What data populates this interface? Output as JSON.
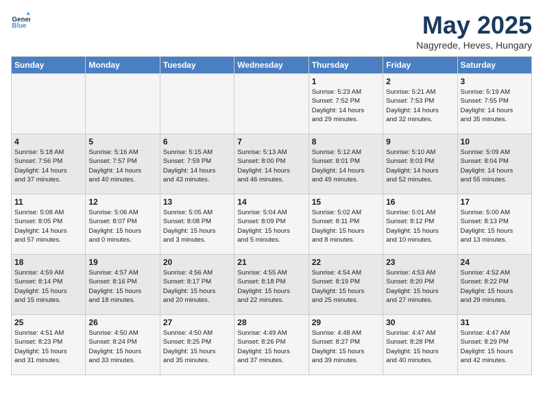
{
  "header": {
    "logo_general": "General",
    "logo_blue": "Blue",
    "title": "May 2025",
    "subtitle": "Nagyrede, Heves, Hungary"
  },
  "calendar": {
    "days_of_week": [
      "Sunday",
      "Monday",
      "Tuesday",
      "Wednesday",
      "Thursday",
      "Friday",
      "Saturday"
    ],
    "weeks": [
      [
        {
          "day": "",
          "info": ""
        },
        {
          "day": "",
          "info": ""
        },
        {
          "day": "",
          "info": ""
        },
        {
          "day": "",
          "info": ""
        },
        {
          "day": "1",
          "info": "Sunrise: 5:23 AM\nSunset: 7:52 PM\nDaylight: 14 hours\nand 29 minutes."
        },
        {
          "day": "2",
          "info": "Sunrise: 5:21 AM\nSunset: 7:53 PM\nDaylight: 14 hours\nand 32 minutes."
        },
        {
          "day": "3",
          "info": "Sunrise: 5:19 AM\nSunset: 7:55 PM\nDaylight: 14 hours\nand 35 minutes."
        }
      ],
      [
        {
          "day": "4",
          "info": "Sunrise: 5:18 AM\nSunset: 7:56 PM\nDaylight: 14 hours\nand 37 minutes."
        },
        {
          "day": "5",
          "info": "Sunrise: 5:16 AM\nSunset: 7:57 PM\nDaylight: 14 hours\nand 40 minutes."
        },
        {
          "day": "6",
          "info": "Sunrise: 5:15 AM\nSunset: 7:59 PM\nDaylight: 14 hours\nand 43 minutes."
        },
        {
          "day": "7",
          "info": "Sunrise: 5:13 AM\nSunset: 8:00 PM\nDaylight: 14 hours\nand 46 minutes."
        },
        {
          "day": "8",
          "info": "Sunrise: 5:12 AM\nSunset: 8:01 PM\nDaylight: 14 hours\nand 49 minutes."
        },
        {
          "day": "9",
          "info": "Sunrise: 5:10 AM\nSunset: 8:03 PM\nDaylight: 14 hours\nand 52 minutes."
        },
        {
          "day": "10",
          "info": "Sunrise: 5:09 AM\nSunset: 8:04 PM\nDaylight: 14 hours\nand 55 minutes."
        }
      ],
      [
        {
          "day": "11",
          "info": "Sunrise: 5:08 AM\nSunset: 8:05 PM\nDaylight: 14 hours\nand 57 minutes."
        },
        {
          "day": "12",
          "info": "Sunrise: 5:06 AM\nSunset: 8:07 PM\nDaylight: 15 hours\nand 0 minutes."
        },
        {
          "day": "13",
          "info": "Sunrise: 5:05 AM\nSunset: 8:08 PM\nDaylight: 15 hours\nand 3 minutes."
        },
        {
          "day": "14",
          "info": "Sunrise: 5:04 AM\nSunset: 8:09 PM\nDaylight: 15 hours\nand 5 minutes."
        },
        {
          "day": "15",
          "info": "Sunrise: 5:02 AM\nSunset: 8:11 PM\nDaylight: 15 hours\nand 8 minutes."
        },
        {
          "day": "16",
          "info": "Sunrise: 5:01 AM\nSunset: 8:12 PM\nDaylight: 15 hours\nand 10 minutes."
        },
        {
          "day": "17",
          "info": "Sunrise: 5:00 AM\nSunset: 8:13 PM\nDaylight: 15 hours\nand 13 minutes."
        }
      ],
      [
        {
          "day": "18",
          "info": "Sunrise: 4:59 AM\nSunset: 8:14 PM\nDaylight: 15 hours\nand 15 minutes."
        },
        {
          "day": "19",
          "info": "Sunrise: 4:57 AM\nSunset: 8:16 PM\nDaylight: 15 hours\nand 18 minutes."
        },
        {
          "day": "20",
          "info": "Sunrise: 4:56 AM\nSunset: 8:17 PM\nDaylight: 15 hours\nand 20 minutes."
        },
        {
          "day": "21",
          "info": "Sunrise: 4:55 AM\nSunset: 8:18 PM\nDaylight: 15 hours\nand 22 minutes."
        },
        {
          "day": "22",
          "info": "Sunrise: 4:54 AM\nSunset: 8:19 PM\nDaylight: 15 hours\nand 25 minutes."
        },
        {
          "day": "23",
          "info": "Sunrise: 4:53 AM\nSunset: 8:20 PM\nDaylight: 15 hours\nand 27 minutes."
        },
        {
          "day": "24",
          "info": "Sunrise: 4:52 AM\nSunset: 8:22 PM\nDaylight: 15 hours\nand 29 minutes."
        }
      ],
      [
        {
          "day": "25",
          "info": "Sunrise: 4:51 AM\nSunset: 8:23 PM\nDaylight: 15 hours\nand 31 minutes."
        },
        {
          "day": "26",
          "info": "Sunrise: 4:50 AM\nSunset: 8:24 PM\nDaylight: 15 hours\nand 33 minutes."
        },
        {
          "day": "27",
          "info": "Sunrise: 4:50 AM\nSunset: 8:25 PM\nDaylight: 15 hours\nand 35 minutes."
        },
        {
          "day": "28",
          "info": "Sunrise: 4:49 AM\nSunset: 8:26 PM\nDaylight: 15 hours\nand 37 minutes."
        },
        {
          "day": "29",
          "info": "Sunrise: 4:48 AM\nSunset: 8:27 PM\nDaylight: 15 hours\nand 39 minutes."
        },
        {
          "day": "30",
          "info": "Sunrise: 4:47 AM\nSunset: 8:28 PM\nDaylight: 15 hours\nand 40 minutes."
        },
        {
          "day": "31",
          "info": "Sunrise: 4:47 AM\nSunset: 8:29 PM\nDaylight: 15 hours\nand 42 minutes."
        }
      ]
    ]
  }
}
